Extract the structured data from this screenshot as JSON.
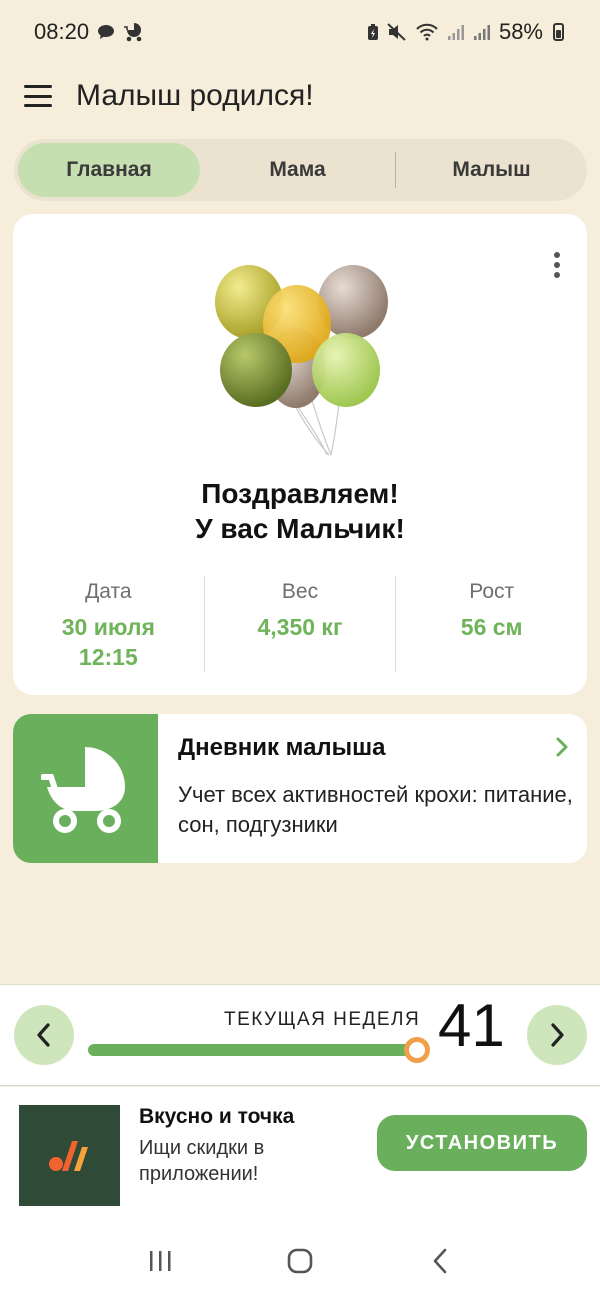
{
  "status_bar": {
    "time": "08:20",
    "battery": "58%",
    "icons": [
      "chat-bubble-icon",
      "stroller-icon",
      "battery-saver-icon",
      "mute-icon",
      "wifi-icon",
      "signal-icon",
      "signal-icon",
      "battery-icon"
    ]
  },
  "app_bar": {
    "title": "Малыш родился!",
    "menu_icon": "menu-icon"
  },
  "tabs": [
    {
      "label": "Главная",
      "active": true
    },
    {
      "label": "Мама",
      "active": false
    },
    {
      "label": "Малыш",
      "active": false
    }
  ],
  "hero": {
    "congrats_line1": "Поздравляем!",
    "congrats_line2": "У вас Мальчик!",
    "image": "balloons",
    "stats": [
      {
        "label": "Дата",
        "value": "30 июля\n12:15"
      },
      {
        "label": "Вес",
        "value": "4,350  кг"
      },
      {
        "label": "Рост",
        "value": "56 см"
      }
    ]
  },
  "diary": {
    "title": "Дневник малыша",
    "description": "Учет всех активностей крохи: питание, сон, подгузники",
    "icon": "stroller-icon"
  },
  "week": {
    "label": "ТЕКУЩАЯ НЕДЕЛЯ",
    "number": "41",
    "progress": 1.0
  },
  "ad": {
    "title": "Вкусно и точка",
    "text": "Ищи скидки в приложении!",
    "button": "УСТАНОВИТЬ"
  },
  "colors": {
    "background": "#f6eedb",
    "accent_green": "#6aaf5c",
    "tab_active": "#c6dfb1",
    "value_green": "#6fb35a",
    "knob_orange": "#f0a04a"
  }
}
